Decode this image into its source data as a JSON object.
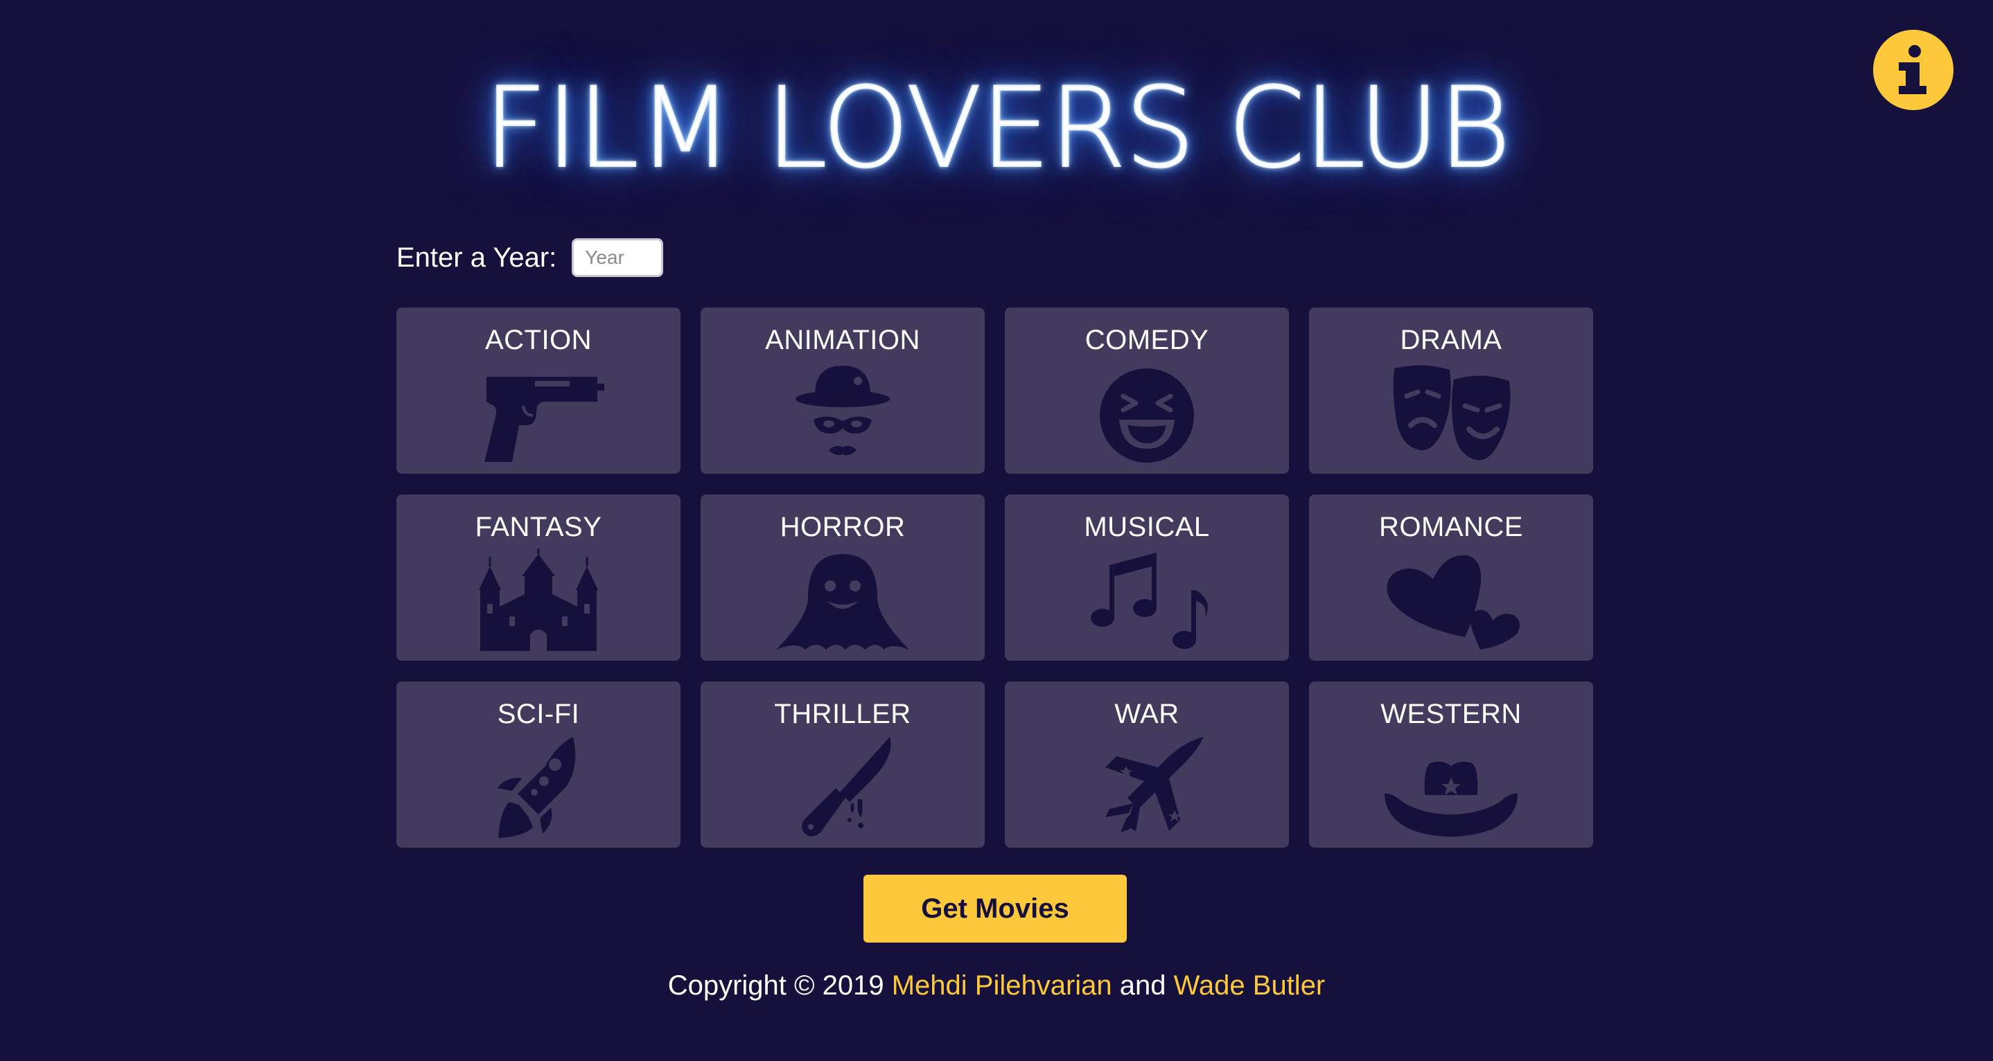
{
  "header": {
    "title": "FILM LOVERS CLUB",
    "info_icon": "info-icon"
  },
  "year_filter": {
    "label": "Enter a Year:",
    "placeholder": "Year",
    "value": ""
  },
  "genres": [
    {
      "label": "ACTION",
      "icon": "pistol-icon"
    },
    {
      "label": "ANIMATION",
      "icon": "bowler-hat-mask-icon"
    },
    {
      "label": "COMEDY",
      "icon": "laughing-face-icon"
    },
    {
      "label": "DRAMA",
      "icon": "theater-masks-icon"
    },
    {
      "label": "FANTASY",
      "icon": "castle-icon"
    },
    {
      "label": "HORROR",
      "icon": "ghost-icon"
    },
    {
      "label": "MUSICAL",
      "icon": "music-notes-icon"
    },
    {
      "label": "ROMANCE",
      "icon": "hearts-icon"
    },
    {
      "label": "SCI-FI",
      "icon": "rocket-icon"
    },
    {
      "label": "THRILLER",
      "icon": "bloody-knife-icon"
    },
    {
      "label": "WAR",
      "icon": "fighter-jet-icon"
    },
    {
      "label": "WESTERN",
      "icon": "cowboy-hat-icon"
    }
  ],
  "actions": {
    "get_movies_label": "Get Movies"
  },
  "footer": {
    "prefix": "Copyright © 2019 ",
    "author1": "Mehdi Pilehvarian",
    "joiner": " and ",
    "author2": "Wade Butler"
  },
  "colors": {
    "background": "#16103c",
    "card": "#433b5d",
    "accent": "#fdc93a",
    "icon": "#16103c",
    "neon_glow": "#3d8bff"
  }
}
